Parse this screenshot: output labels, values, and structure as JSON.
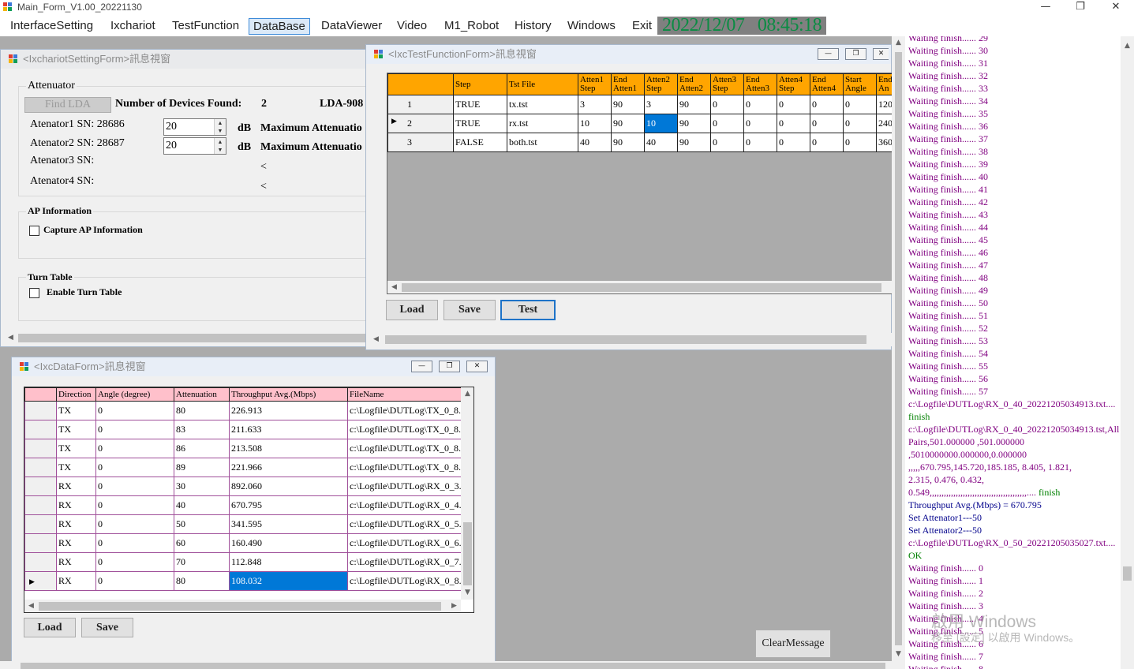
{
  "app": {
    "title": "Main_Form_V1.00_20221130",
    "controls": {
      "minimize": "—",
      "restore": "❐",
      "close": "✕"
    }
  },
  "menu": {
    "items": [
      "InterfaceSetting",
      "Ixchariot",
      "TestFunction",
      "DataBase",
      "DataViewer",
      "Video",
      "M1_Robot",
      "History",
      "Windows",
      "Exit"
    ],
    "selected": "DataBase",
    "clock": "2022/12/07   08:45:18"
  },
  "setting_form": {
    "caption": "<IxchariotSettingForm>訊息視窗",
    "attenuator_title": "Attenuator",
    "find_lda": "Find LDA",
    "devices_found_label": "Number of Devices Found:",
    "devices_found_value": "2",
    "lda_model": "LDA-908",
    "att1_label": "Atenator1 SN: 28686",
    "att1_value": "20",
    "att2_label": "Atenator2 SN: 28687",
    "att2_value": "20",
    "att3_label": "Atenator3 SN:",
    "att4_label": "Atenator4 SN:",
    "db": "dB",
    "max_att": "Maximum Attenuatio",
    "lt": "<",
    "ap_title": "AP Information",
    "capture_ap": "Capture AP Information",
    "turn_title": "Turn Table",
    "enable_turn": "Enable Turn Table"
  },
  "test_form": {
    "caption": "<IxcTestFunctionForm>訊息視窗",
    "headers": [
      "Step",
      "Tst File",
      "Atten1\nStep",
      "End\nAtten1",
      "Atten2\nStep",
      "End\nAtten2",
      "Atten3\nStep",
      "End\nAtten3",
      "Atten4\nStep",
      "End\nAtten4",
      "Start\nAngle",
      "End\nAn"
    ],
    "rows": [
      {
        "no": "1",
        "cells": [
          "TRUE",
          "tx.tst",
          "3",
          "90",
          "3",
          "90",
          "0",
          "0",
          "0",
          "0",
          "0",
          "120"
        ]
      },
      {
        "no": "2",
        "cells": [
          "TRUE",
          "rx.tst",
          "10",
          "90",
          "10",
          "90",
          "0",
          "0",
          "0",
          "0",
          "0",
          "240"
        ]
      },
      {
        "no": "3",
        "cells": [
          "FALSE",
          "both.tst",
          "40",
          "90",
          "40",
          "90",
          "0",
          "0",
          "0",
          "0",
          "0",
          "360"
        ]
      }
    ],
    "current_marker": "▶",
    "load": "Load",
    "save": "Save",
    "test": "Test"
  },
  "data_form": {
    "caption": "<IxcDataForm>訊息視窗",
    "headers": [
      "Direction",
      "Angle (degree)",
      "Attenuation",
      "Throughput Avg.(Mbps)",
      "FileName"
    ],
    "rows": [
      [
        "TX",
        "0",
        "80",
        "226.913",
        "c:\\Logfile\\DUTLog\\TX_0_8..."
      ],
      [
        "TX",
        "0",
        "83",
        "211.633",
        "c:\\Logfile\\DUTLog\\TX_0_8..."
      ],
      [
        "TX",
        "0",
        "86",
        "213.508",
        "c:\\Logfile\\DUTLog\\TX_0_8..."
      ],
      [
        "TX",
        "0",
        "89",
        "221.966",
        "c:\\Logfile\\DUTLog\\TX_0_8..."
      ],
      [
        "RX",
        "0",
        "30",
        "892.060",
        "c:\\Logfile\\DUTLog\\RX_0_3..."
      ],
      [
        "RX",
        "0",
        "40",
        "670.795",
        "c:\\Logfile\\DUTLog\\RX_0_4..."
      ],
      [
        "RX",
        "0",
        "50",
        "341.595",
        "c:\\Logfile\\DUTLog\\RX_0_5..."
      ],
      [
        "RX",
        "0",
        "60",
        "160.490",
        "c:\\Logfile\\DUTLog\\RX_0_6..."
      ],
      [
        "RX",
        "0",
        "70",
        "112.848",
        "c:\\Logfile\\DUTLog\\RX_0_7..."
      ],
      [
        "RX",
        "0",
        "80",
        "108.032",
        "c:\\Logfile\\DUTLog\\RX_0_8..."
      ]
    ],
    "current_marker": "▶",
    "load": "Load",
    "save": "Save"
  },
  "clear_message": "ClearMessage",
  "log": [
    {
      "t": "Waiting finish...... 29",
      "c": "p"
    },
    {
      "t": "Waiting finish...... 30",
      "c": "p"
    },
    {
      "t": "Waiting finish...... 31",
      "c": "p"
    },
    {
      "t": "Waiting finish...... 32",
      "c": "p"
    },
    {
      "t": "Waiting finish...... 33",
      "c": "p"
    },
    {
      "t": "Waiting finish...... 34",
      "c": "p"
    },
    {
      "t": "Waiting finish...... 35",
      "c": "p"
    },
    {
      "t": "Waiting finish...... 36",
      "c": "p"
    },
    {
      "t": "Waiting finish...... 37",
      "c": "p"
    },
    {
      "t": "Waiting finish...... 38",
      "c": "p"
    },
    {
      "t": "Waiting finish...... 39",
      "c": "p"
    },
    {
      "t": "Waiting finish...... 40",
      "c": "p"
    },
    {
      "t": "Waiting finish...... 41",
      "c": "p"
    },
    {
      "t": "Waiting finish...... 42",
      "c": "p"
    },
    {
      "t": "Waiting finish...... 43",
      "c": "p"
    },
    {
      "t": "Waiting finish...... 44",
      "c": "p"
    },
    {
      "t": "Waiting finish...... 45",
      "c": "p"
    },
    {
      "t": "Waiting finish...... 46",
      "c": "p"
    },
    {
      "t": "Waiting finish...... 47",
      "c": "p"
    },
    {
      "t": "Waiting finish...... 48",
      "c": "p"
    },
    {
      "t": "Waiting finish...... 49",
      "c": "p"
    },
    {
      "t": "Waiting finish...... 50",
      "c": "p"
    },
    {
      "t": "Waiting finish...... 51",
      "c": "p"
    },
    {
      "t": "Waiting finish...... 52",
      "c": "p"
    },
    {
      "t": "Waiting finish...... 53",
      "c": "p"
    },
    {
      "t": "Waiting finish...... 54",
      "c": "p"
    },
    {
      "t": "Waiting finish...... 55",
      "c": "p"
    },
    {
      "t": "Waiting finish...... 56",
      "c": "p"
    },
    {
      "t": "Waiting finish...... 57",
      "c": "p"
    },
    {
      "t": "c:\\Logfile\\DUTLog\\RX_0_40_20221205034913.txt....",
      "c": "p"
    },
    {
      "t": "finish",
      "c": "g"
    },
    {
      "t": "c:\\Logfile\\DUTLog\\RX_0_40_20221205034913.tst,All",
      "c": "p"
    },
    {
      "t": "Pairs,501.000000     ,501.000000",
      "c": "p"
    },
    {
      "t": ",5010000000.000000,0.000000",
      "c": "p"
    },
    {
      "t": ",,,,,670.795,145.720,185.185,     8.405,     1.821,",
      "c": "p"
    },
    {
      "t": "2.315,     0.476,     0.432,",
      "c": "p"
    },
    {
      "t": "0.549,,,,,,,,,,,,,,,,,,,,,,,,,,,,,,,,,,,,,,,,,.... finish",
      "c": "p",
      "tail_green": true
    },
    {
      "t": "Throughput Avg.(Mbps) = 670.795",
      "c": "b"
    },
    {
      "t": "Set Attenator1---50",
      "c": "b"
    },
    {
      "t": "Set Attenator2---50",
      "c": "b"
    },
    {
      "t": "c:\\Logfile\\DUTLog\\RX_0_50_20221205035027.txt....",
      "c": "p"
    },
    {
      "t": "OK",
      "c": "g"
    },
    {
      "t": "Waiting finish...... 0",
      "c": "p"
    },
    {
      "t": "Waiting finish...... 1",
      "c": "p"
    },
    {
      "t": "Waiting finish...... 2",
      "c": "p"
    },
    {
      "t": "Waiting finish...... 3",
      "c": "p"
    },
    {
      "t": "Waiting finish...... 4",
      "c": "p"
    },
    {
      "t": "Waiting finish...... 5",
      "c": "p"
    },
    {
      "t": "Waiting finish...... 6",
      "c": "p"
    },
    {
      "t": "Waiting finish...... 7",
      "c": "p"
    },
    {
      "t": "Waiting finish...... 8",
      "c": "p"
    }
  ],
  "watermark": {
    "line1": "啟用 Windows",
    "line2": "移至 [設定] 以啟用 Windows。"
  },
  "colors": {
    "grid_header_orange": "#ffa500",
    "grid_header_pink": "#ffc0cb",
    "selection": "#0078d7",
    "clock_text": "#0b8c43",
    "log_purple": "#800080",
    "log_blue": "#00008b",
    "log_green": "#008000"
  }
}
